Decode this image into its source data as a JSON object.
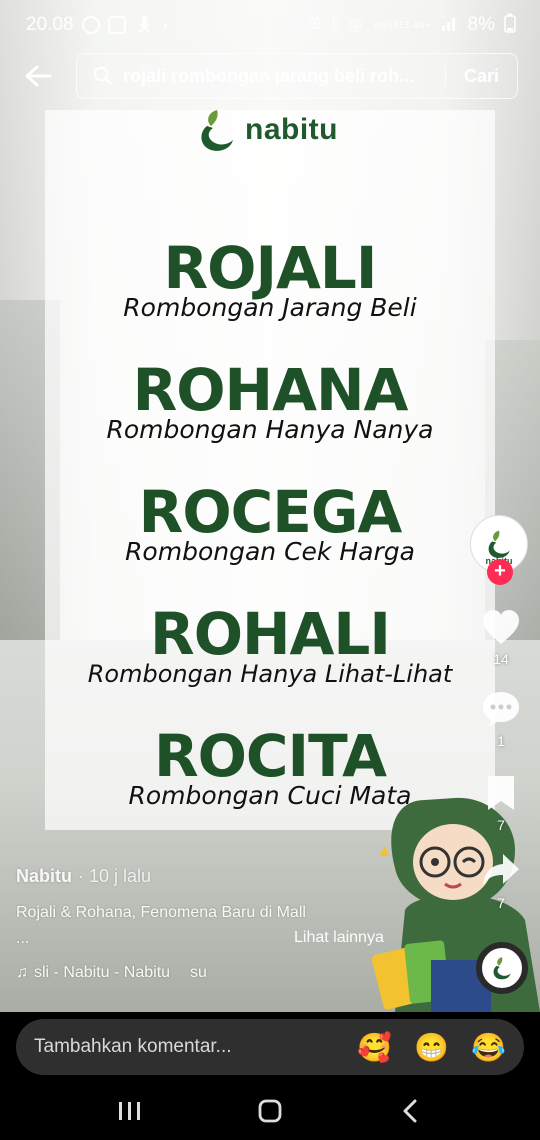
{
  "status_bar": {
    "time": "20.08",
    "network_label": "Vo) LTE1 4G+",
    "battery": "8%"
  },
  "search": {
    "query": "rojali rombongan jarang beli roh...",
    "button_label": "Cari"
  },
  "video": {
    "brand": "nabitu",
    "terms": [
      {
        "acronym": "ROJALI",
        "meaning": "Rombongan Jarang Beli"
      },
      {
        "acronym": "ROHANA",
        "meaning": "Rombongan Hanya Nanya"
      },
      {
        "acronym": "ROCEGA",
        "meaning": "Rombongan Cek Harga"
      },
      {
        "acronym": "ROHALI",
        "meaning": "Rombongan Hanya Lihat-Lihat"
      },
      {
        "acronym": "ROCITA",
        "meaning": "Rombongan Cuci Mata"
      }
    ]
  },
  "rail": {
    "avatar_label": "nabitu",
    "follow_symbol": "+",
    "likes": "14",
    "comments": "1",
    "saves": "7",
    "shares": "7"
  },
  "caption": {
    "author": "Nabitu",
    "time": "· 10 j lalu",
    "description": "Rojali & Rohana, Fenomena Baru di Mall",
    "ellipsis": "...",
    "see_more": "Lihat lainnya",
    "music": "sli - Nabitu - Nabitu",
    "music_extra": "su"
  },
  "comment": {
    "placeholder": "Tambahkan komentar...",
    "emojis": [
      "🥰",
      "😁",
      "😂"
    ]
  },
  "colors": {
    "brand_green": "#1e5128",
    "like_red": "#fe2c55"
  }
}
